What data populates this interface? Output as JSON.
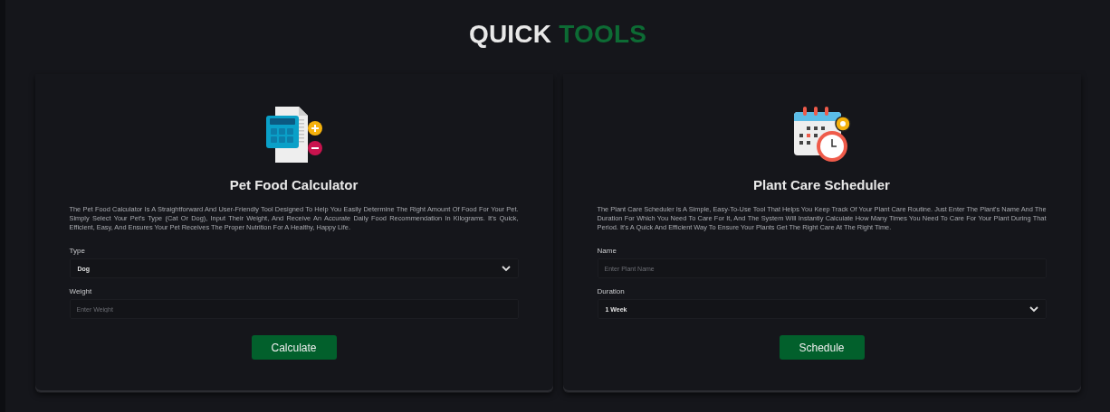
{
  "header": {
    "title": [
      {
        "text": "QUICK",
        "accent": false
      },
      {
        "text": "TOOLS",
        "accent": true
      }
    ]
  },
  "cards": [
    {
      "kind": "calculator",
      "title": "Pet Food Calculator",
      "description": "The Pet Food Calculator Is A Straightforward And User-Friendly Tool Designed To Help You Easily Determine The Right Amount Of Food For Your Pet. Simply Select Your Pet's Type (Cat Or Dog), Input Their Weight, And Receive An Accurate Daily Food Recommendation In Kilograms. It's Quick, Efficient, Easy, And Ensures Your Pet Receives The Proper Nutrition For A Healthy, Happy Life.",
      "fields": [
        {
          "kind": "select",
          "label": "Type",
          "value": "Dog"
        },
        {
          "kind": "input",
          "label": "Weight",
          "placeholder": "Enter Weight"
        }
      ],
      "button": "Calculate"
    },
    {
      "kind": "scheduler",
      "title": "Plant Care Scheduler",
      "description": "The Plant Care Scheduler Is A Simple, Easy-To-Use Tool That Helps You Keep Track Of Your Plant Care Routine. Just Enter The Plant's Name And The Duration For Which You Need To Care For It, And The System Will Instantly Calculate How Many Times You Need To Care For Your Plant During That Period. It's A Quick And Efficient Way To Ensure Your Plants Get The Right Care At The Right Time.",
      "fields": [
        {
          "kind": "input",
          "label": "Name",
          "placeholder": "Enter Plant Name"
        },
        {
          "kind": "select",
          "label": "Duration",
          "value": "1 Week"
        }
      ],
      "button": "Schedule"
    }
  ]
}
